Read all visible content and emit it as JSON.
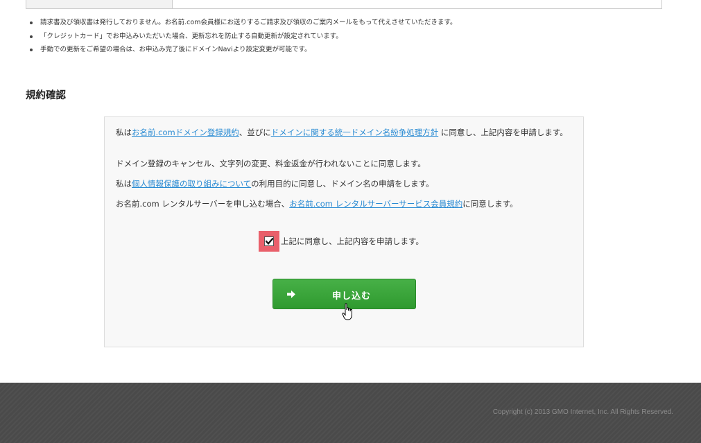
{
  "notes": [
    "請求書及び領収書は発行しておりません。お名前.com会員様にお送りするご請求及び領収のご案内メールをもって代えさせていただきます。",
    "「クレジットカード」でお申込みいただいた場合、更新忘れを防止する自動更新が設定されています。",
    "手動での更新をご希望の場合は、お申込み完了後にドメインNaviより設定変更が可能です。"
  ],
  "section_title": "規約確認",
  "terms": {
    "p1_pre": "私は",
    "p1_link1": "お名前.comドメイン登録規約",
    "p1_mid": "、並びに",
    "p1_link2": "ドメインに関する統一ドメイン名紛争処理方針",
    "p1_post": " に同意し、上記内容を申請します。",
    "p2": "ドメイン登録のキャンセル、文字列の変更、料金返金が行われないことに同意します。",
    "p3_pre": "私は",
    "p3_link": "個人情報保護の取り組みについて",
    "p3_post": "の利用目的に同意し、ドメイン名の申請をします。",
    "p4_pre": "お名前.com レンタルサーバーを申し込む場合、",
    "p4_link": "お名前.com レンタルサーバーサービス会員規約",
    "p4_post": "に同意します。"
  },
  "agree_checkbox": {
    "label": "上記に同意し、上記内容を申請します。",
    "checked": true
  },
  "submit_button": {
    "label": "申し込む"
  },
  "footer": {
    "copyright": "Copyright (c) 2013 GMO Internet, Inc. All Rights Reserved."
  },
  "colors": {
    "link": "#2a8bd3",
    "button": "#3ca33c",
    "checkbox_highlight": "#e9606b",
    "footer_bg": "#4a4a4a"
  }
}
